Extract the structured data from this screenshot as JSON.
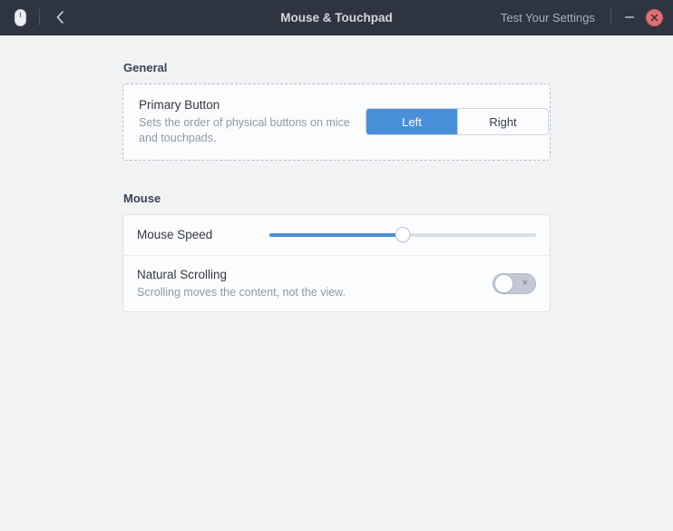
{
  "header": {
    "app_icon": "mouse-icon",
    "back_icon": "chevron-left-icon",
    "title": "Mouse & Touchpad",
    "test_button_label": "Test Your Settings",
    "minimize_icon": "minimize-icon",
    "close_icon": "close-icon",
    "bg_color": "#2e3440",
    "close_color": "#e06c75"
  },
  "sections": [
    {
      "title": "General",
      "rows": [
        {
          "title": "Primary Button",
          "subtitle": "Sets the order of physical buttons on mice and touchpads.",
          "control": "segmented",
          "options": [
            "Left",
            "Right"
          ],
          "selected": "Left"
        }
      ]
    },
    {
      "title": "Mouse",
      "rows": [
        {
          "title": "Mouse Speed",
          "subtitle": "",
          "control": "slider",
          "value": 50,
          "min": 0,
          "max": 100
        },
        {
          "title": "Natural Scrolling",
          "subtitle": "Scrolling moves the content, not the view.",
          "control": "switch",
          "state": "off",
          "off_mark": "×"
        }
      ]
    }
  ],
  "colors": {
    "accent": "#4a90d9",
    "page_bg": "#f2f3f5",
    "card_bg": "#fbfcfd",
    "switch_off": "#c3c8d4"
  }
}
